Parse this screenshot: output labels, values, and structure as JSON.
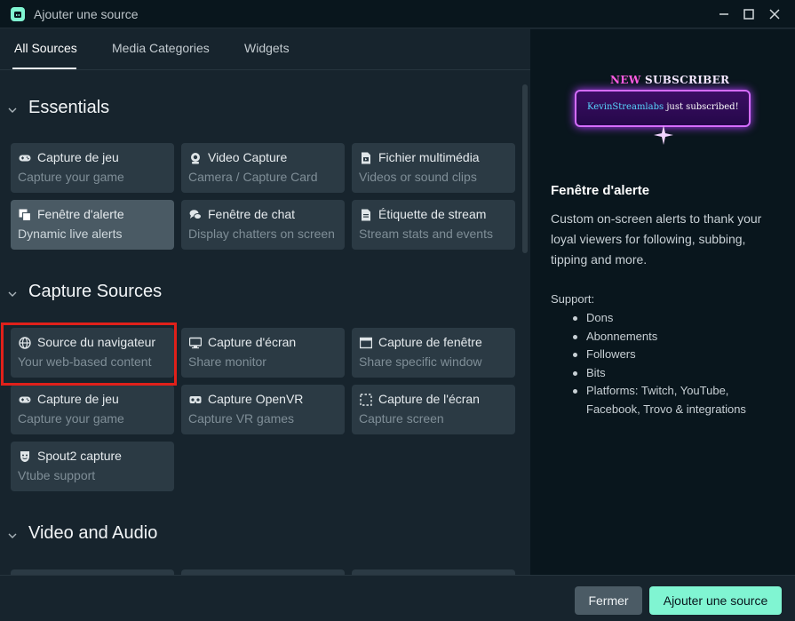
{
  "window": {
    "title": "Ajouter une source"
  },
  "tabs": [
    {
      "label": "All Sources"
    },
    {
      "label": "Media Categories"
    },
    {
      "label": "Widgets"
    }
  ],
  "sections": [
    {
      "title": "Essentials",
      "cards": [
        {
          "title": "Capture de jeu",
          "subtitle": "Capture your game",
          "icon": "gamepad-icon"
        },
        {
          "title": "Video Capture",
          "subtitle": "Camera / Capture Card",
          "icon": "webcam-icon"
        },
        {
          "title": "Fichier multimédia",
          "subtitle": "Videos or sound clips",
          "icon": "file-media-icon"
        },
        {
          "title": "Fenêtre d'alerte",
          "subtitle": "Dynamic live alerts",
          "icon": "alert-box-icon",
          "selected": true
        },
        {
          "title": "Fenêtre de chat",
          "subtitle": "Display chatters on screen",
          "icon": "chat-icon"
        },
        {
          "title": "Étiquette de stream",
          "subtitle": "Stream stats and events",
          "icon": "document-icon"
        }
      ]
    },
    {
      "title": "Capture Sources",
      "cards": [
        {
          "title": "Source du navigateur",
          "subtitle": "Your web-based content",
          "icon": "globe-icon",
          "highlighted": true
        },
        {
          "title": "Capture d'écran",
          "subtitle": "Share monitor",
          "icon": "monitor-icon"
        },
        {
          "title": "Capture de fenêtre",
          "subtitle": "Share specific window",
          "icon": "window-icon"
        },
        {
          "title": "Capture de jeu",
          "subtitle": "Capture your game",
          "icon": "gamepad-icon"
        },
        {
          "title": "Capture OpenVR",
          "subtitle": "Capture VR games",
          "icon": "vr-headset-icon"
        },
        {
          "title": "Capture de l'écran",
          "subtitle": "Capture screen",
          "icon": "dashed-region-icon"
        },
        {
          "title": "Spout2 capture",
          "subtitle": "Vtube support",
          "icon": "mask-icon"
        }
      ]
    },
    {
      "title": "Video and Audio",
      "cards": []
    }
  ],
  "preview": {
    "new_label": "NEW",
    "subscriber_label": "SUBSCRIBER",
    "username": "KevinStreamlabs",
    "message": "just subscribed!"
  },
  "details": {
    "title": "Fenêtre d'alerte",
    "description": "Custom on-screen alerts to thank your loyal viewers for following, subbing, tipping and more.",
    "support_label": "Support:",
    "support_items": [
      "Dons",
      "Abonnements",
      "Followers",
      "Bits",
      "Platforms: Twitch, YouTube, Facebook, Trovo & integrations"
    ]
  },
  "footer": {
    "close_label": "Fermer",
    "add_label": "Ajouter une source"
  },
  "colors": {
    "accent": "#80f5d2",
    "highlight_border": "#e0201a",
    "card_bg": "#2b3a44",
    "card_selected_bg": "#4a5a64"
  }
}
